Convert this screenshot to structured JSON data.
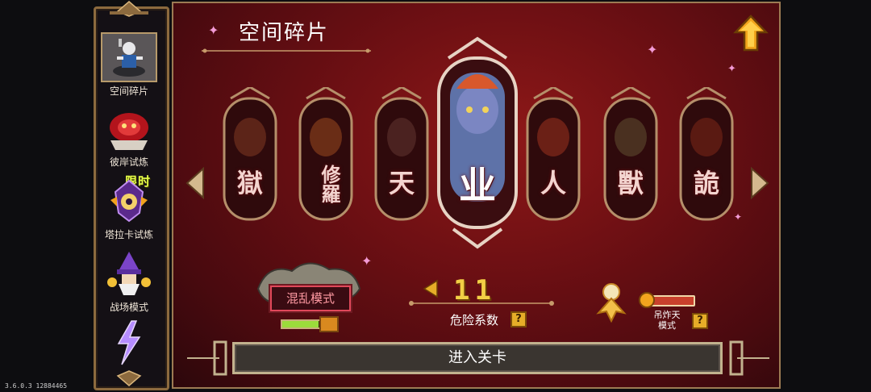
{
  "sidebar": {
    "items": [
      {
        "label": "空间碎片",
        "icon": "portal-warrior-icon",
        "active": true
      },
      {
        "label": "彼岸试炼",
        "icon": "red-spirit-icon",
        "active": false
      },
      {
        "label": "塔拉卡试炼",
        "icon": "taraka-crest-icon",
        "active": false
      },
      {
        "label": "战场模式",
        "icon": "wizard-icon",
        "active": false
      },
      {
        "label": "",
        "icon": "lightning-icon",
        "active": false
      }
    ],
    "limited_tag": "限时"
  },
  "main": {
    "title": "空间碎片",
    "cards": [
      {
        "glyph": "獄"
      },
      {
        "glyph": "修羅"
      },
      {
        "glyph": "天"
      },
      {
        "glyph": "业"
      },
      {
        "glyph": "人"
      },
      {
        "glyph": "獸"
      },
      {
        "glyph": "詭"
      }
    ],
    "chaos_mode": {
      "label": "混乱模式",
      "level": 0.8
    },
    "danger": {
      "value": "11",
      "label": "危险系数",
      "help": "?"
    },
    "hanging_mode": {
      "label_line1": "吊炸天",
      "label_line2": "模式",
      "help": "?"
    },
    "enter_button": "进入关卡"
  },
  "version": "3.6.0.3 12884465",
  "colors": {
    "panel_red": "#6b0f13",
    "gold": "#f2cf45",
    "chaos_border": "#e0485a"
  }
}
